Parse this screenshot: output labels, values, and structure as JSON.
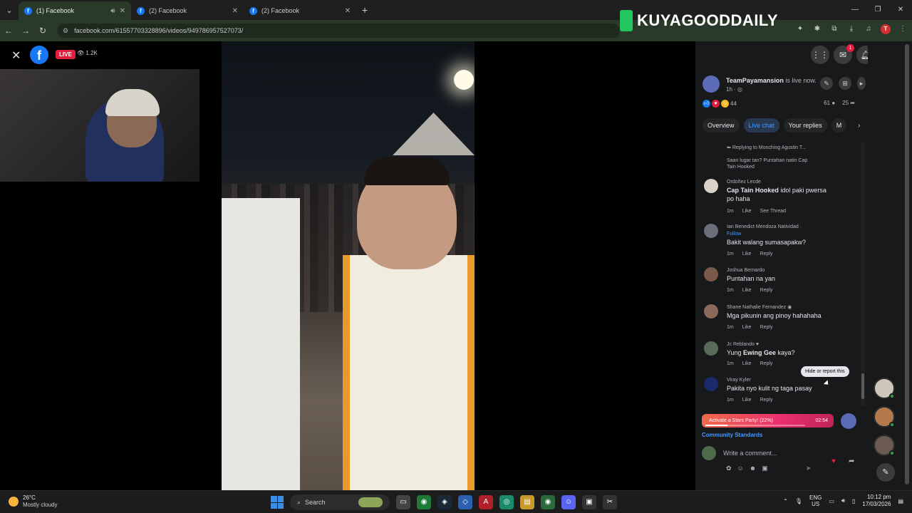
{
  "browser": {
    "tabs": [
      {
        "title": "(1) Facebook",
        "active": true
      },
      {
        "title": "(2) Facebook",
        "active": false
      },
      {
        "title": "(2) Facebook",
        "active": false
      }
    ],
    "url": "facebook.com/61557703328896/videos/949786957527073/",
    "watermark": "KUYAGOODDAILY"
  },
  "viewer": {
    "live_label": "LIVE",
    "viewer_count": "1.2K"
  },
  "panel": {
    "messenger_badge": "1",
    "host": {
      "name": "TeamPayamansion",
      "status": " is live now.",
      "time": "1h · "
    },
    "reaction_count": "44",
    "comment_count": "61",
    "share_count": "25",
    "tabs": [
      "Overview",
      "Live chat",
      "Your replies",
      "M"
    ],
    "selected_tab": "Live chat",
    "replying_to": "Replying to Monching Agustin T...",
    "quoted_text": "Saan lugar tan? Puntahan natin Cap Tain Hooked",
    "comments": [
      {
        "author": "Ordoñez Lecde",
        "follow": "",
        "text_bold": "Cap Tain Hooked",
        "text": " idol paki pwersa po haha",
        "time": "1m",
        "like": "Like",
        "action": "See Thread"
      },
      {
        "author": "Ian Benedict Mendoza Natividad ·",
        "follow": "Follow",
        "text_bold": "",
        "text": "Bakit walang sumasapakw?",
        "time": "1m",
        "like": "Like",
        "action": "Reply"
      },
      {
        "author": "Joshua Bernardo",
        "follow": "",
        "text_bold": "",
        "text": "Puntahan na yan",
        "time": "1m",
        "like": "Like",
        "action": "Reply"
      },
      {
        "author": "Shane Nathalie Fernandez",
        "follow": "",
        "text_bold": "",
        "text": "Mga pikunin ang pinoy hahahaha",
        "time": "1m",
        "like": "Like",
        "action": "Reply"
      },
      {
        "author": "Jc Reblando",
        "follow": "",
        "text_bold": "Ewing Gee",
        "text_pre": "Yung ",
        "text": " kaya?",
        "time": "1m",
        "like": "Like",
        "action": "Reply"
      },
      {
        "author": "Viray Kyler",
        "follow": "",
        "text_bold": "",
        "text": "Pakita nyo kulit ng taga pasay",
        "time": "1m",
        "like": "Like",
        "action": "Reply"
      }
    ],
    "tooltip": "Hide or report this",
    "stars_party": {
      "label": "Activate a Stars Party! (22%)",
      "progress": 0.22,
      "timer": "02:54"
    },
    "community_standards": "Community Standards",
    "composer_placeholder": "Write a comment..."
  },
  "taskbar": {
    "temperature": "26°C",
    "weather": "Mostly cloudy",
    "search_label": "Search",
    "lang_top": "ENG",
    "lang_bottom": "US",
    "time": "10:12 pm",
    "date": "17/03/2026"
  }
}
